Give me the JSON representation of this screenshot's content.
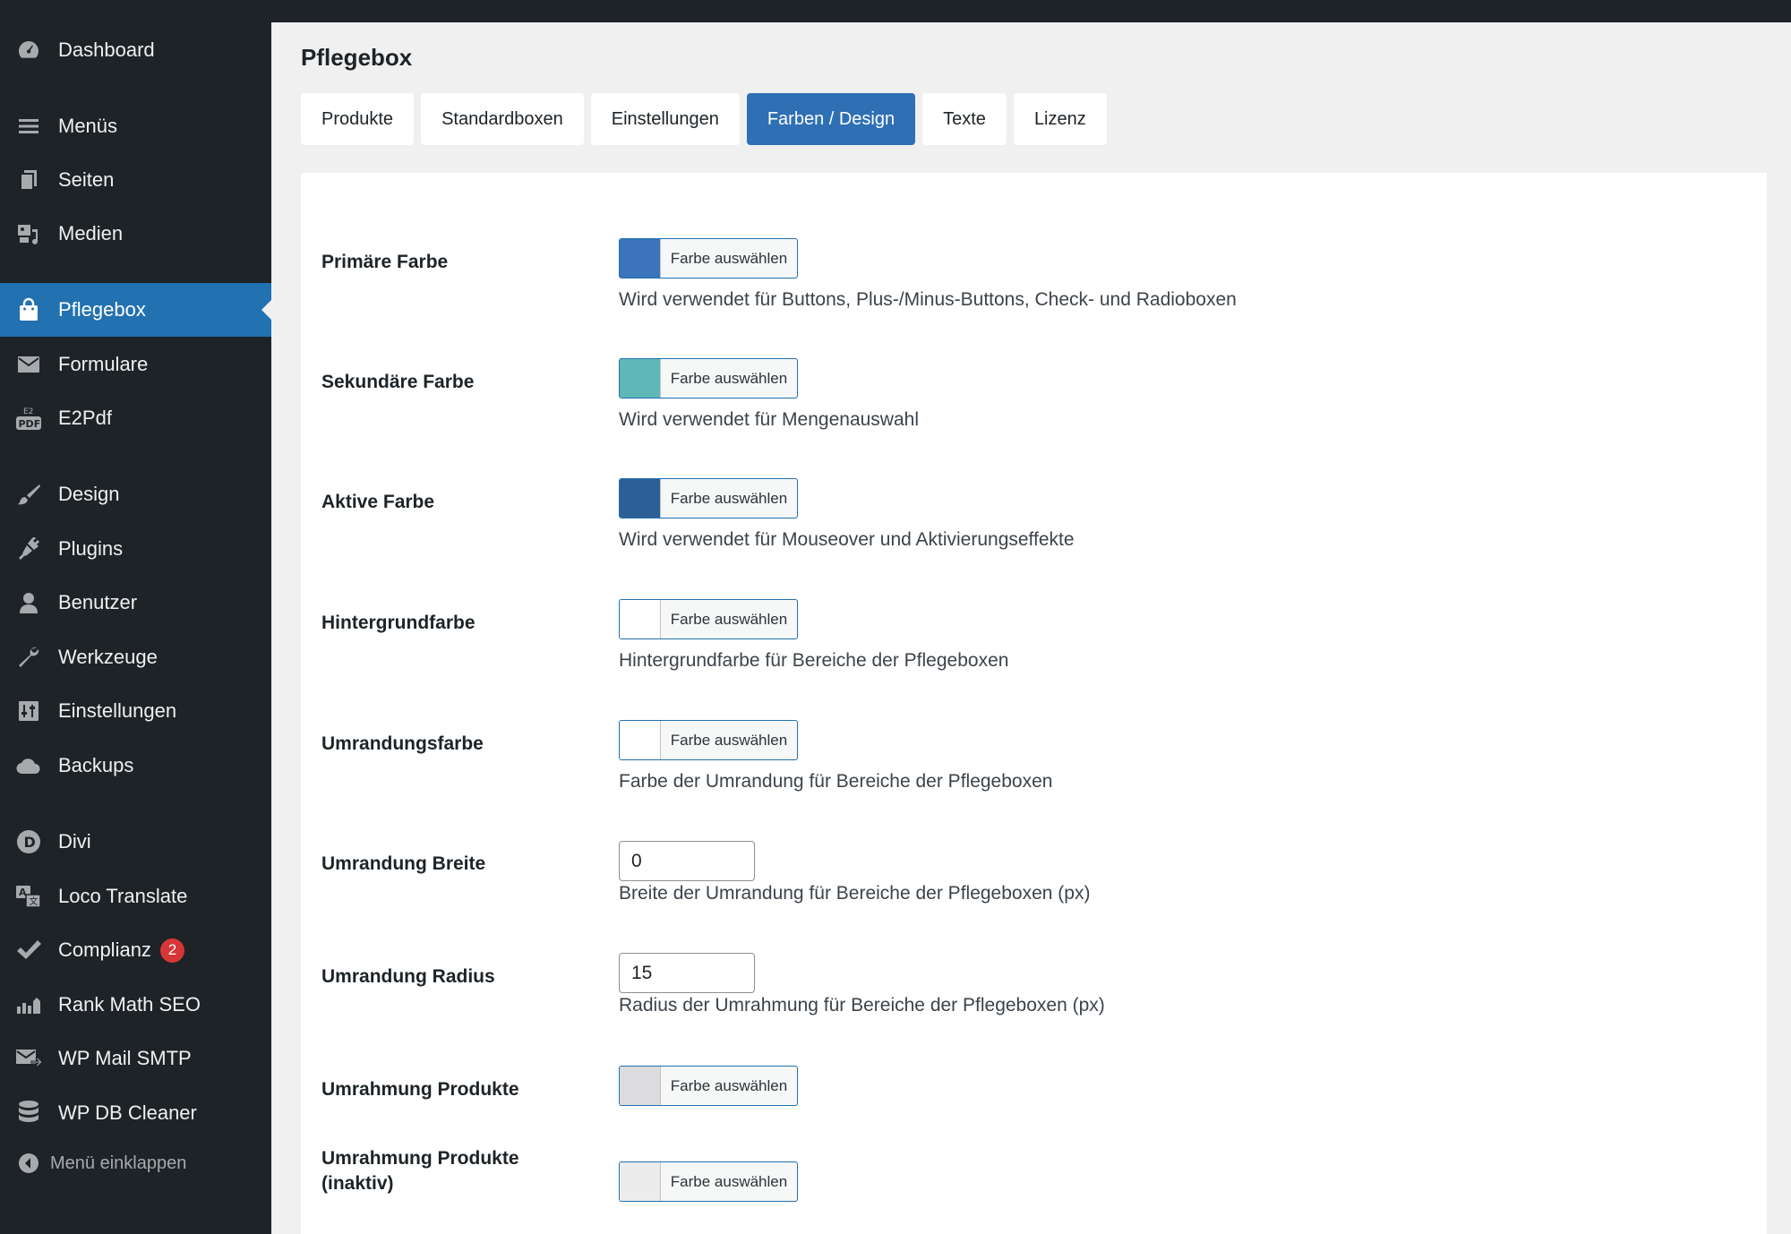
{
  "sidebar": {
    "items": [
      {
        "label": "Dashboard",
        "icon": "dashboard-icon"
      },
      {
        "label": "Menüs",
        "icon": "menu-lines-icon"
      },
      {
        "label": "Seiten",
        "icon": "pages-icon"
      },
      {
        "label": "Medien",
        "icon": "media-icon"
      },
      {
        "label": "Pflegebox",
        "icon": "shopping-bag-icon"
      },
      {
        "label": "Formulare",
        "icon": "envelope-icon"
      },
      {
        "label": "E2Pdf",
        "icon": "e2pdf-icon"
      },
      {
        "label": "Design",
        "icon": "paintbrush-icon"
      },
      {
        "label": "Plugins",
        "icon": "plugin-icon"
      },
      {
        "label": "Benutzer",
        "icon": "user-icon"
      },
      {
        "label": "Werkzeuge",
        "icon": "wrench-icon"
      },
      {
        "label": "Einstellungen",
        "icon": "settings-icon"
      },
      {
        "label": "Backups",
        "icon": "cloud-icon"
      },
      {
        "label": "Divi",
        "icon": "divi-icon"
      },
      {
        "label": "Loco Translate",
        "icon": "translate-icon"
      },
      {
        "label": "Complianz",
        "icon": "checkmark-icon",
        "badge": "2"
      },
      {
        "label": "Rank Math SEO",
        "icon": "chart-icon"
      },
      {
        "label": "WP Mail SMTP",
        "icon": "mail-icon"
      },
      {
        "label": "WP DB Cleaner",
        "icon": "database-icon"
      }
    ],
    "collapse_label": "Menü einklappen"
  },
  "page": {
    "title": "Pflegebox",
    "tabs": [
      {
        "label": "Produkte"
      },
      {
        "label": "Standardboxen"
      },
      {
        "label": "Einstellungen"
      },
      {
        "label": "Farben / Design"
      },
      {
        "label": "Texte"
      },
      {
        "label": "Lizenz"
      }
    ],
    "active_tab": "Farben / Design"
  },
  "settings": {
    "color_button_label": "Farbe auswählen",
    "rows": [
      {
        "label": "Primäre Farbe",
        "type": "color",
        "color": "#3b74bb",
        "desc": "Wird verwendet für Buttons, Plus-/Minus-Buttons, Check- und Radioboxen"
      },
      {
        "label": "Sekundäre Farbe",
        "type": "color",
        "color": "#5fb8b7",
        "desc": "Wird verwendet für Mengenauswahl"
      },
      {
        "label": "Aktive Farbe",
        "type": "color",
        "color": "#2c5f95",
        "desc": "Wird verwendet für Mouseover und Aktivierungseffekte"
      },
      {
        "label": "Hintergrundfarbe",
        "type": "color",
        "color": "#ffffff",
        "desc": "Hintergrundfarbe für Bereiche der Pflegeboxen"
      },
      {
        "label": "Umrandungsfarbe",
        "type": "color",
        "color": "#ffffff",
        "desc": "Farbe der Umrandung für Bereiche der Pflegeboxen"
      },
      {
        "label": "Umrandung Breite",
        "type": "number",
        "value": "0",
        "desc": "Breite der Umrandung für Bereiche der Pflegeboxen (px)"
      },
      {
        "label": "Umrandung Radius",
        "type": "number",
        "value": "15",
        "desc": "Radius der Umrahmung für Bereiche der Pflegeboxen (px)"
      },
      {
        "label": "Umrahmung Produkte",
        "type": "color",
        "color": "#dcdcde",
        "desc": ""
      },
      {
        "label": "Umrahmung Produkte (inaktiv)",
        "type": "color",
        "color": "#ececec",
        "desc": ""
      }
    ]
  },
  "colors": {
    "sidebar_bg": "#1d2327",
    "accent": "#2271b1",
    "badge": "#d63638"
  }
}
